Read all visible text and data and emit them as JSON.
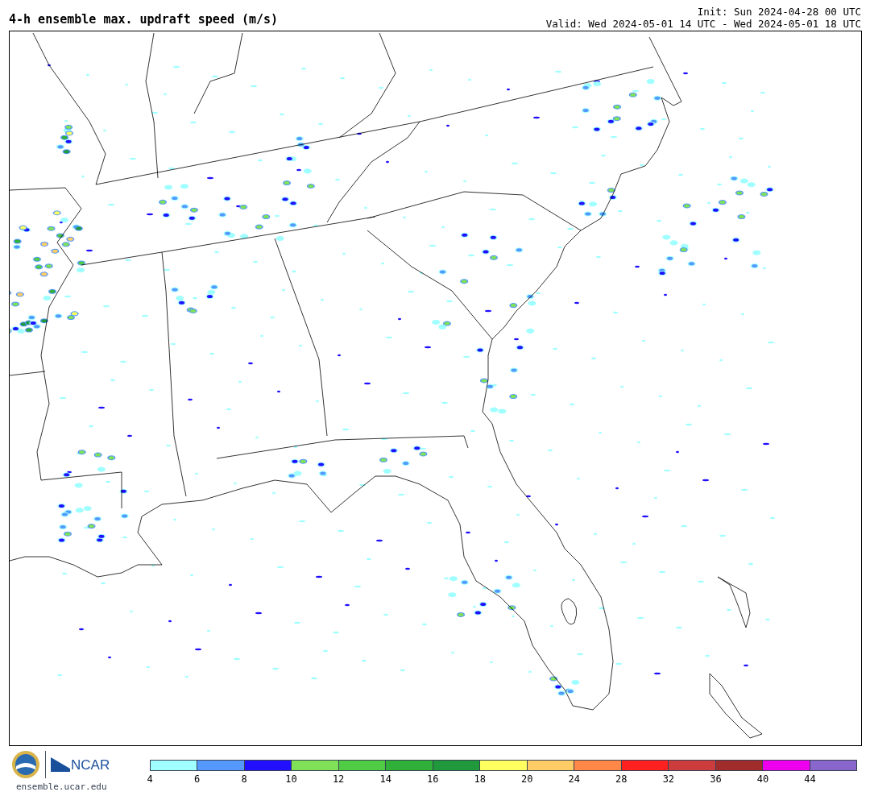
{
  "title": "4-h ensemble max. updraft speed (m/s)",
  "init": "Init: Sun 2024-04-28 00 UTC",
  "valid": "Valid: Wed 2024-05-01 14 UTC - Wed 2024-05-01 18 UTC",
  "footer": {
    "logo_text": "NCAR",
    "site": "ensemble.ucar.edu"
  },
  "colorbar": [
    {
      "label": "4",
      "color": "#a0ffff"
    },
    {
      "label": "6",
      "color": "#5599ff"
    },
    {
      "label": "8",
      "color": "#2010ff"
    },
    {
      "label": "10",
      "color": "#80e058"
    },
    {
      "label": "12",
      "color": "#50cc44"
    },
    {
      "label": "14",
      "color": "#30b038"
    },
    {
      "label": "16",
      "color": "#20983c"
    },
    {
      "label": "18",
      "color": "#ffff60"
    },
    {
      "label": "20",
      "color": "#ffcc66"
    },
    {
      "label": "24",
      "color": "#ff8848"
    },
    {
      "label": "28",
      "color": "#ff2020"
    },
    {
      "label": "32",
      "color": "#cc3c3c"
    },
    {
      "label": "36",
      "color": "#a02c2c"
    },
    {
      "label": "40",
      "color": "#ee00ee"
    },
    {
      "label": "44",
      "color": "#8866cc"
    }
  ]
}
